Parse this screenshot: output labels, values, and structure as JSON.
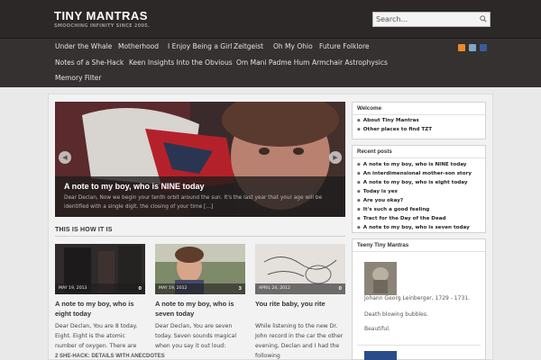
{
  "site": {
    "title": "TINY MANTRAS",
    "tagline": "SMOOCHING INFINITY SINCE 2005."
  },
  "search": {
    "placeholder": "Search..."
  },
  "nav": {
    "items": [
      "Under the Whale",
      "Motherhood",
      "I Enjoy Being a Girl",
      "Zeitgeist",
      "Oh My Ohio",
      "Future Folklore",
      "Notes of a She-Hack",
      "Keen Insights Into the Obvious",
      "Om Mani Padme Hum",
      "Armchair Astrophysics",
      "Memory Filter"
    ],
    "social_icons": [
      "rss-icon",
      "twitter-icon",
      "facebook-icon"
    ]
  },
  "slider": {
    "title": "A note to my boy, who is NINE today",
    "excerpt": "Dear Declan, Now we begin your tenth orbit around the sun. It's the last year that your age will be identified with a single digit, the closing of your time […]",
    "prev_icon": "chevron-left-icon",
    "next_icon": "chevron-right-icon"
  },
  "section": {
    "heading": "THIS IS HOW IT IS"
  },
  "cards": [
    {
      "date": "MAY 19, 2013",
      "comments": "0",
      "title": "A note to my boy, who is eight today",
      "excerpt": "Dear Declan, You are 8 today. Eight. Eight is the atomic number of oxygen.  There are"
    },
    {
      "date": "MAY 19, 2012",
      "comments": "3",
      "title": "A note to my boy, who is seven today",
      "excerpt": "Dear Declan, You are seven today. Seven sounds magical when you say it out loud:"
    },
    {
      "date": "APRIL 24, 2012",
      "comments": "0",
      "title": "You rite baby, you rite",
      "excerpt": "While listening to the new Dr. John record in the car the other evening, Declan and I had the following"
    }
  ],
  "footer_heading": "2 SHE-HACK: DETAILS WITH ANECDOTES",
  "sidebar": {
    "welcome": {
      "title": "Welcome",
      "links": [
        "About Tiny Mantras",
        "Other places to find TZT"
      ]
    },
    "recent": {
      "title": "Recent posts",
      "links": [
        "A note to my boy, who is NINE today",
        "An interdimensional mother-son story",
        "A note to my boy, who is eight today",
        "Today is yes",
        "Are you okay?",
        "It's such a good feeling",
        "Tract for the Day of the Dead",
        "A note to my boy, who is seven today"
      ]
    },
    "teeny": {
      "title": "Teeny Tiny Mantras",
      "caption": "Johann Georg Leinberger, 1729 - 1731.",
      "line2": "Death blowing bubbles.",
      "line3": "Beautiful."
    }
  }
}
